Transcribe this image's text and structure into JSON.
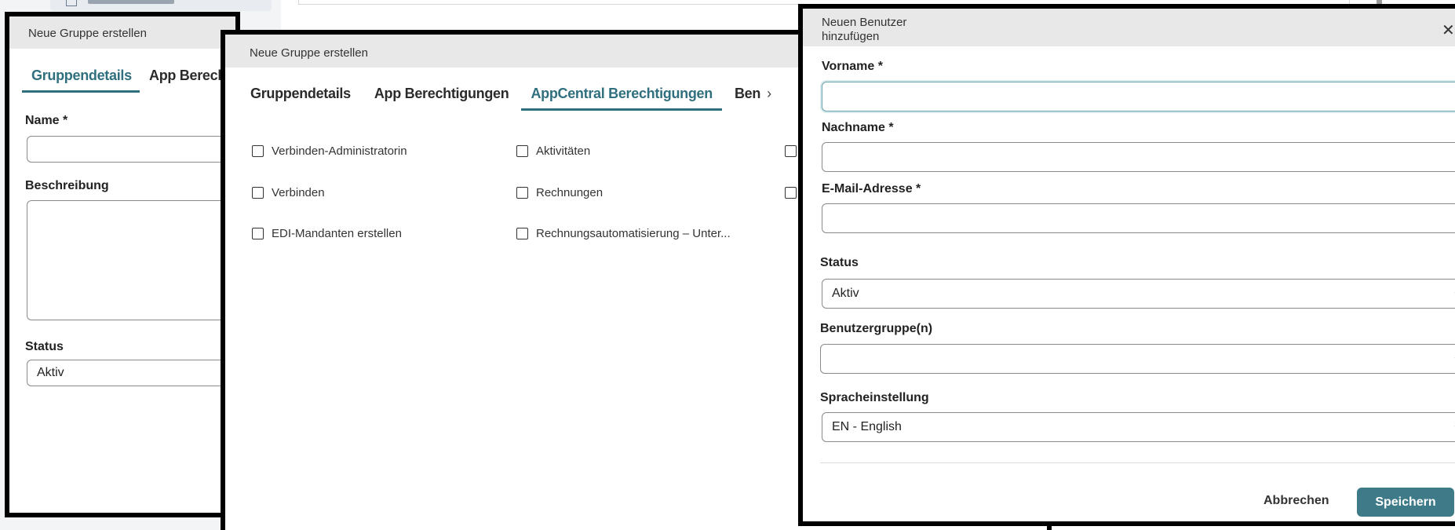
{
  "dialog_group_back": {
    "title": "Neue Gruppe erstellen",
    "tabs": [
      {
        "label": "Gruppendetails",
        "active": true
      },
      {
        "label": "App Berech",
        "active": false
      }
    ],
    "name_label": "Name *",
    "description_label": "Beschreibung",
    "status_label": "Status",
    "status_value": "Aktiv"
  },
  "dialog_group_mid": {
    "title": "Neue Gruppe erstellen",
    "tabs": [
      {
        "label": "Gruppendetails",
        "active": false
      },
      {
        "label": "App Berechtigungen",
        "active": false
      },
      {
        "label": "AppCentral Berechtigungen",
        "active": true
      },
      {
        "label": "Ben",
        "active": false
      }
    ],
    "tab_next_icon": "chevron-right-icon",
    "permissions_col1": [
      "Verbinden-Administratorin",
      "Verbinden",
      "EDI-Mandanten erstellen"
    ],
    "permissions_col2": [
      "Aktivitäten",
      "Rechnungen",
      "Rechnungsautomatisierung – Unter..."
    ]
  },
  "dialog_user": {
    "title_line1": "Neuen Benutzer",
    "title_line2": "hinzufügen",
    "close_icon": "close-icon",
    "first_name_label": "Vorname *",
    "first_name_value": "",
    "last_name_label": "Nachname *",
    "last_name_value": "",
    "email_label": "E-Mail-Adresse *",
    "email_value": "",
    "status_label": "Status",
    "status_value": "Aktiv",
    "groups_label": "Benutzergruppe(n)",
    "groups_value": "",
    "language_label": "Spracheinstellung",
    "language_value": "EN - English",
    "cancel_label": "Abbrechen",
    "save_label": "Speichern"
  },
  "colors": {
    "accent": "#2f6f7e",
    "primary_button": "#3e7a87",
    "dialog_header": "#e8e8e8"
  }
}
